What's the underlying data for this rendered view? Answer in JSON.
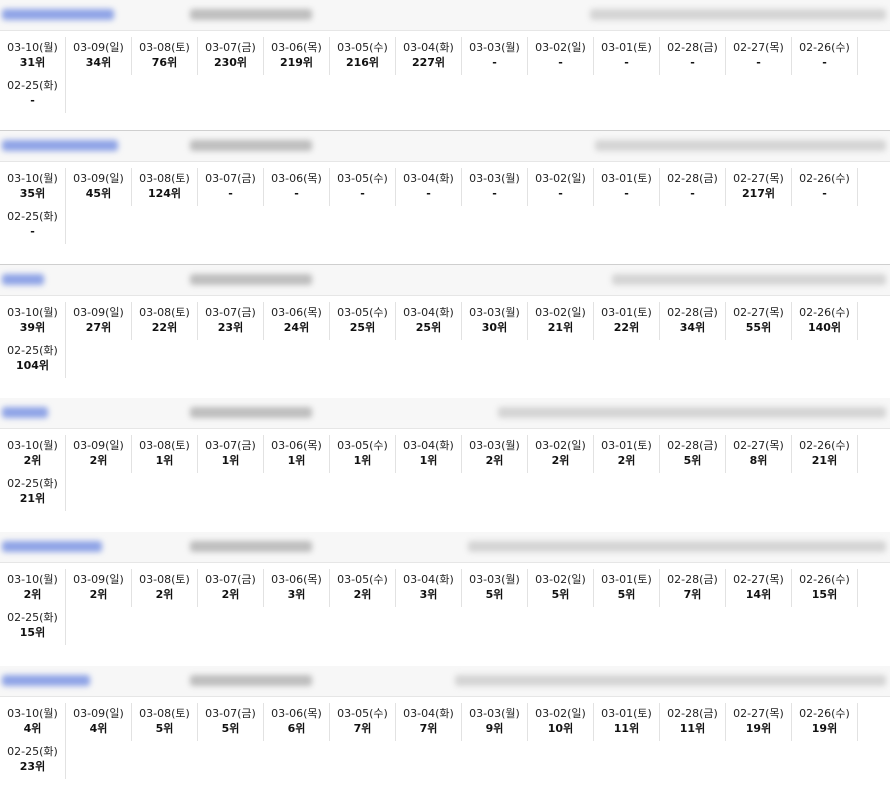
{
  "dates": [
    "03-10(월)",
    "03-09(일)",
    "03-08(토)",
    "03-07(금)",
    "03-06(목)",
    "03-05(수)",
    "03-04(화)",
    "03-03(월)",
    "03-02(일)",
    "03-01(토)",
    "02-28(금)",
    "02-27(목)",
    "02-26(수)",
    "02-25(화)"
  ],
  "blocks": [
    {
      "ranks": [
        "31위",
        "34위",
        "76위",
        "230위",
        "219위",
        "216위",
        "227위",
        "-",
        "-",
        "-",
        "-",
        "-",
        "-",
        "-"
      ]
    },
    {
      "ranks": [
        "35위",
        "45위",
        "124위",
        "-",
        "-",
        "-",
        "-",
        "-",
        "-",
        "-",
        "-",
        "217위",
        "-",
        "-"
      ]
    },
    {
      "ranks": [
        "39위",
        "27위",
        "22위",
        "23위",
        "24위",
        "25위",
        "25위",
        "30위",
        "21위",
        "22위",
        "34위",
        "55위",
        "140위",
        "104위"
      ]
    },
    {
      "ranks": [
        "2위",
        "2위",
        "1위",
        "1위",
        "1위",
        "1위",
        "1위",
        "2위",
        "2위",
        "2위",
        "5위",
        "8위",
        "21위",
        "21위"
      ]
    },
    {
      "ranks": [
        "2위",
        "2위",
        "2위",
        "2위",
        "3위",
        "2위",
        "3위",
        "5위",
        "5위",
        "5위",
        "7위",
        "14위",
        "15위",
        "15위"
      ]
    },
    {
      "ranks": [
        "4위",
        "4위",
        "5위",
        "5위",
        "6위",
        "7위",
        "7위",
        "9위",
        "10위",
        "11위",
        "11위",
        "19위",
        "19위",
        "23위"
      ]
    }
  ]
}
